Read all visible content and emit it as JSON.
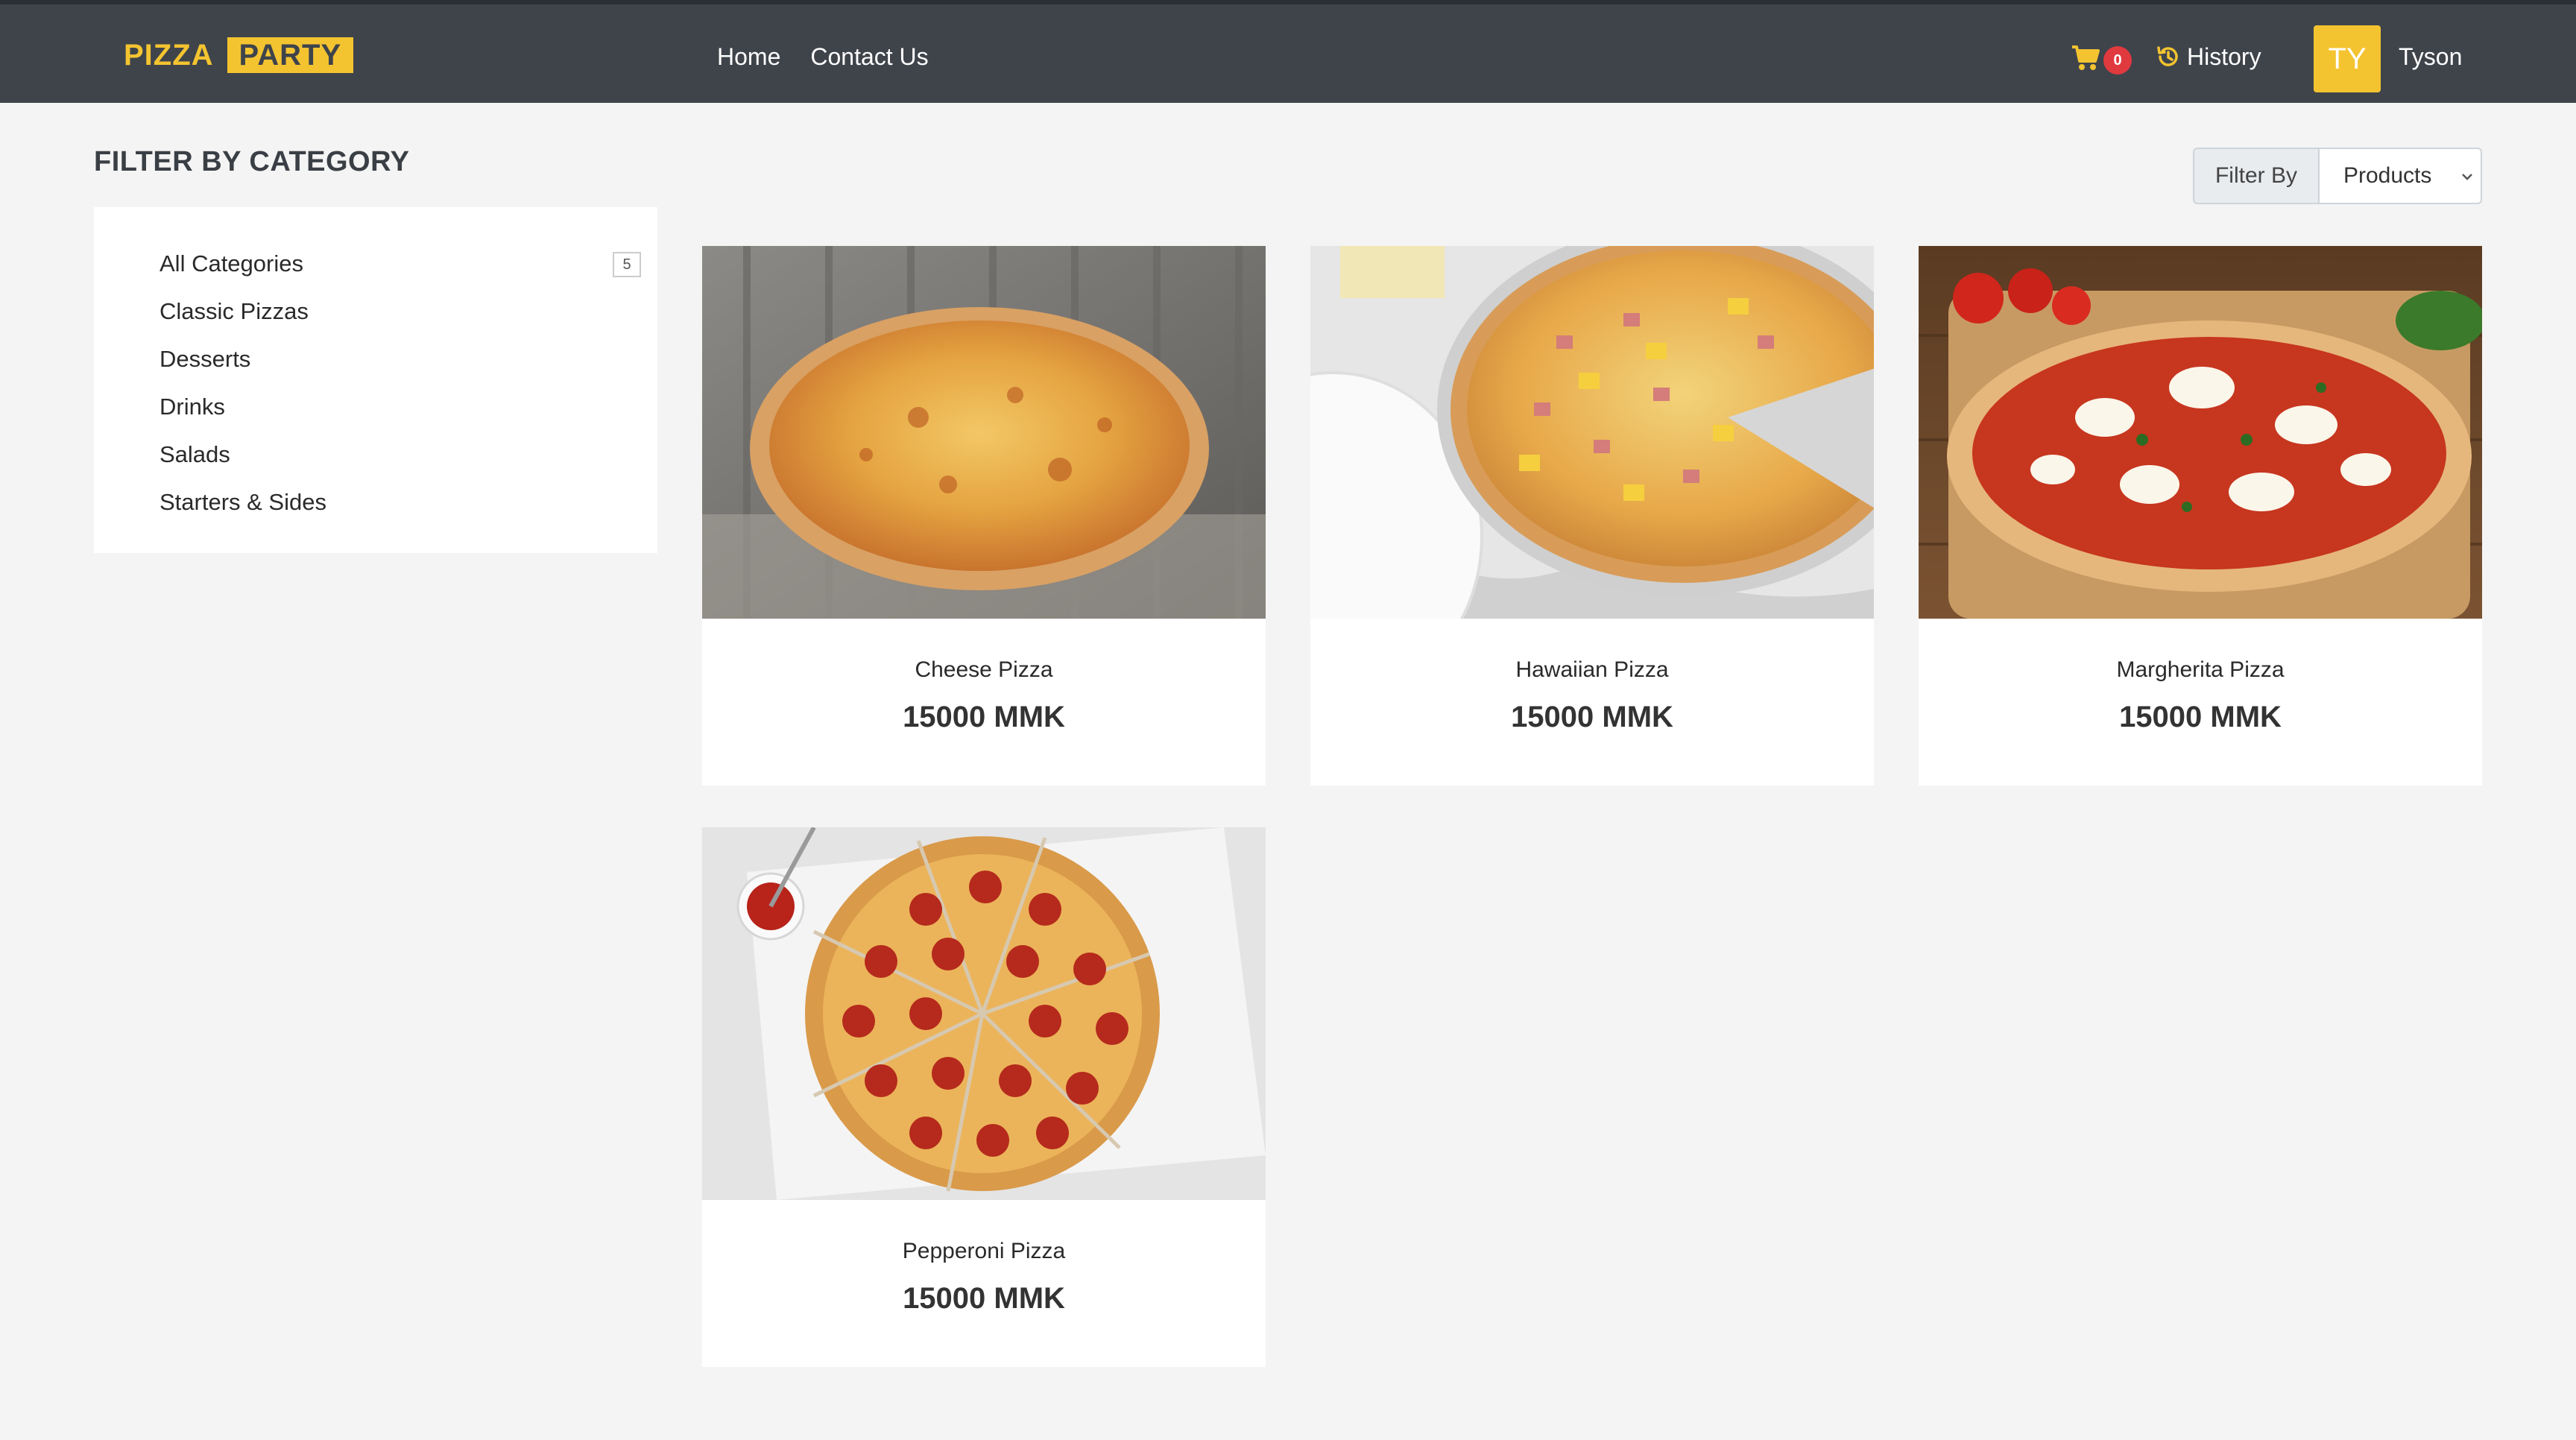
{
  "nav": {
    "brand_part1": "PIZZA",
    "brand_part2": "PARTY",
    "links": [
      "Home",
      "Contact Us"
    ],
    "cart_count": "0",
    "history_label": "History",
    "avatar_initials": "TY",
    "username": "Tyson"
  },
  "sidebar": {
    "heading": "FILTER BY CATEGORY",
    "categories": [
      {
        "label": "All Categories",
        "count": "5"
      },
      {
        "label": "Classic Pizzas"
      },
      {
        "label": "Desserts"
      },
      {
        "label": "Drinks"
      },
      {
        "label": "Salads"
      },
      {
        "label": "Starters & Sides"
      }
    ]
  },
  "filter": {
    "label": "Filter By",
    "selected": "Products"
  },
  "products": [
    {
      "name": "Cheese Pizza",
      "price": "15000 MMK",
      "image": "cheese-pizza-photo"
    },
    {
      "name": "Hawaiian Pizza",
      "price": "15000 MMK",
      "image": "hawaiian-pizza-photo"
    },
    {
      "name": "Margherita Pizza",
      "price": "15000 MMK",
      "image": "margherita-pizza-photo"
    },
    {
      "name": "Pepperoni Pizza",
      "price": "15000 MMK",
      "image": "pepperoni-pizza-photo"
    }
  ],
  "colors": {
    "navbar": "#3f444b",
    "accent": "#f4c430",
    "badge": "#e0393e",
    "page_bg": "#f4f4f4"
  }
}
